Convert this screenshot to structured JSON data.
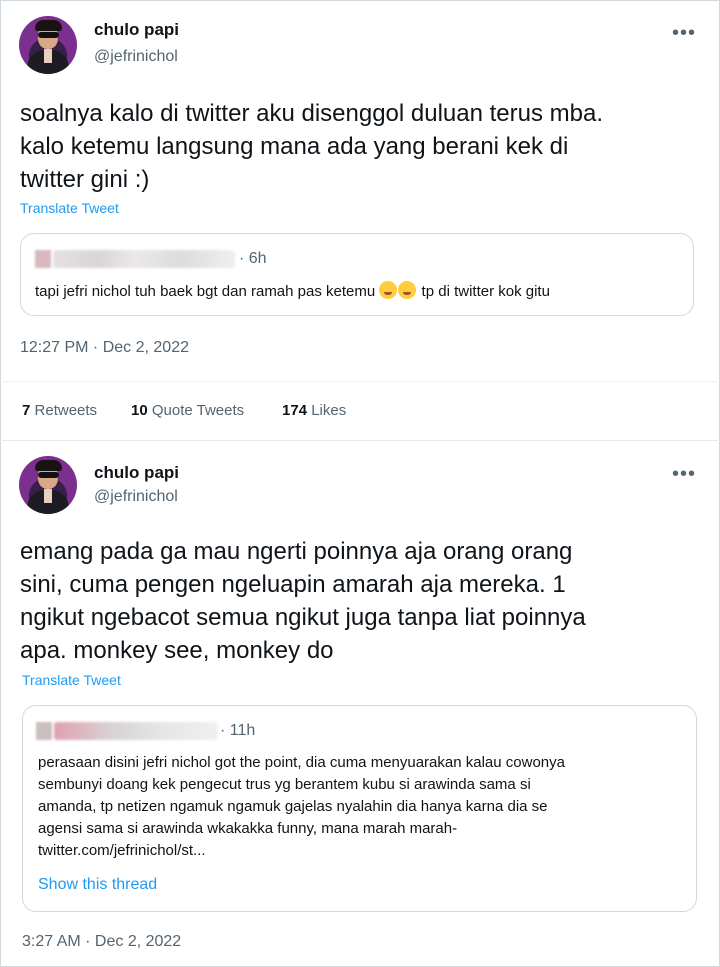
{
  "tweets": [
    {
      "author_name": "chulo papi",
      "author_handle": "@jefrinichol",
      "more_icon": "more-dots-icon",
      "text_lines": [
        "soalnya kalo di twitter aku disenggol duluan terus mba.",
        "kalo ketemu langsung mana ada yang berani kek di",
        "twitter gini :)"
      ],
      "translate_label": "Translate Tweet",
      "quote": {
        "time": "· 6h",
        "text_before": "tapi jefri nichol tuh baek bgt dan ramah pas ketemu",
        "text_after": "tp di twitter kok gitu"
      },
      "timestamp": "12:27 PM · Dec 2, 2022",
      "stats": {
        "retweets_count": "7",
        "retweets_label": "Retweets",
        "quotes_count": "10",
        "quotes_label": "Quote Tweets",
        "likes_count": "174",
        "likes_label": "Likes"
      }
    },
    {
      "author_name": "chulo papi",
      "author_handle": "@jefrinichol",
      "more_icon": "more-dots-icon",
      "text_lines": [
        "emang pada ga mau ngerti poinnya aja orang orang",
        "sini, cuma pengen ngeluapin amarah aja mereka. 1",
        "ngikut ngebacot semua ngikut juga tanpa liat poinnya",
        "apa. monkey see, monkey do"
      ],
      "translate_label": "Translate Tweet",
      "quote": {
        "time": "· 11h",
        "text_lines": [
          "perasaan disini jefri nichol got the point, dia cuma menyuarakan kalau cowonya",
          "sembunyi doang kek pengecut trus yg berantem kubu si arawinda sama si",
          "amanda, tp netizen ngamuk ngamuk gajelas nyalahin dia hanya karna dia se",
          "agensi sama si arawinda wkakakka funny, mana marah marah-",
          "twitter.com/jefrinichol/st..."
        ],
        "show_thread_label": "Show this thread"
      },
      "timestamp": "3:27 AM · Dec 2, 2022"
    }
  ]
}
